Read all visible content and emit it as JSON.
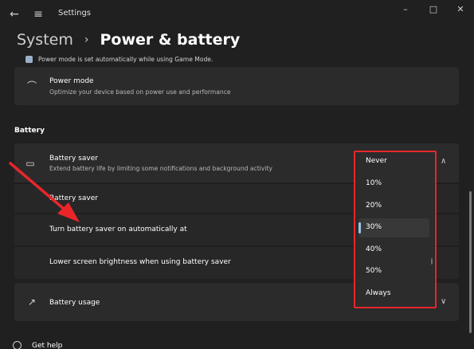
{
  "window": {
    "title": "Settings",
    "back_icon": "←",
    "menu_icon": "≡",
    "minimize_icon": "–",
    "maximize_icon": "□",
    "close_icon": "✕"
  },
  "breadcrumb": {
    "root": "System",
    "separator": "›",
    "current": "Power & battery"
  },
  "note": {
    "text": "Power mode is set automatically while using Game Mode."
  },
  "power_mode": {
    "icon": "⌒",
    "title": "Power mode",
    "subtitle": "Optimize your device based on power use and performance"
  },
  "battery": {
    "section_label": "Battery",
    "battery_saver": {
      "icon": "▭",
      "title": "Battery saver",
      "subtitle": "Extend battery life by limiting some notifications and background activity",
      "chevron": "∧"
    },
    "sub_rows": [
      "Battery saver",
      "Turn battery saver on automatically at",
      "Lower screen brightness when using battery saver"
    ],
    "battery_usage": {
      "icon": "↗",
      "title": "Battery usage",
      "chevron": "∨"
    }
  },
  "dropdown": {
    "options": [
      "Never",
      "10%",
      "20%",
      "30%",
      "40%",
      "50%",
      "Always"
    ],
    "selected": "30%"
  },
  "help": {
    "label": "Get help"
  },
  "colors": {
    "background": "#202020",
    "card": "#2b2b2b",
    "accent": "#9cc4e6",
    "annotation_red": "#e8262a"
  }
}
